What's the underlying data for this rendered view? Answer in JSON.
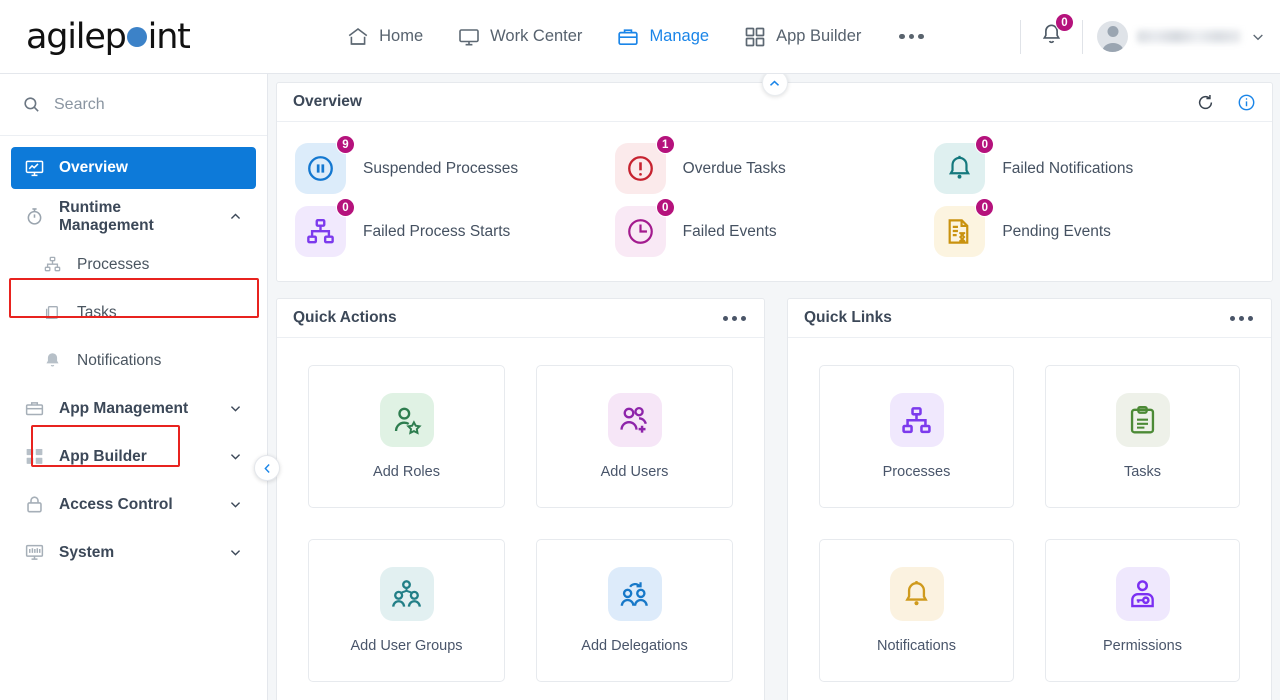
{
  "brand": {
    "name_part1": "agilep",
    "name_part2": "int",
    "dot_color": "#3c82c8"
  },
  "topnav": {
    "items": [
      {
        "label": "Home",
        "icon": "home-icon",
        "active": false
      },
      {
        "label": "Work Center",
        "icon": "monitor-icon",
        "active": false
      },
      {
        "label": "Manage",
        "icon": "briefcase-icon",
        "active": true
      },
      {
        "label": "App Builder",
        "icon": "grid-icon",
        "active": false
      }
    ],
    "more_label": "more-menu",
    "notification_count": "0",
    "user_name": ""
  },
  "sidebar": {
    "search": {
      "placeholder": "Search",
      "value": ""
    },
    "items": [
      {
        "label": "Overview",
        "icon": "dashboard-monitor-icon",
        "active": true,
        "level": 0,
        "caret": ""
      },
      {
        "label": "Runtime Management",
        "icon": "stopwatch-icon",
        "active": false,
        "level": 0,
        "caret": "up",
        "highlighted": true
      },
      {
        "label": "Processes",
        "icon": "org-chart-icon",
        "active": false,
        "level": 1,
        "caret": ""
      },
      {
        "label": "Tasks",
        "icon": "documents-icon",
        "active": false,
        "level": 1,
        "caret": ""
      },
      {
        "label": "Notifications",
        "icon": "bell-icon",
        "active": false,
        "level": 1,
        "caret": "",
        "highlighted": true
      },
      {
        "label": "App Management",
        "icon": "toolbox-icon",
        "active": false,
        "level": 0,
        "caret": "down"
      },
      {
        "label": "App Builder",
        "icon": "app-grid-icon",
        "active": false,
        "level": 0,
        "caret": "down"
      },
      {
        "label": "Access Control",
        "icon": "lock-icon",
        "active": false,
        "level": 0,
        "caret": "down"
      },
      {
        "label": "System",
        "icon": "system-monitor-icon",
        "active": false,
        "level": 0,
        "caret": "down"
      }
    ],
    "collapse_icon": "chevron-left-icon"
  },
  "overview": {
    "title": "Overview",
    "refresh_icon": "refresh-icon",
    "info_icon": "info-icon",
    "collapse_icon": "chevron-up-icon",
    "stats": [
      {
        "label": "Suspended Processes",
        "count": "9",
        "icon": "pause-circle-icon",
        "color": "#1478d0",
        "bg": "#dcecfa"
      },
      {
        "label": "Overdue Tasks",
        "count": "1",
        "icon": "exclamation-circle-icon",
        "color": "#c62330",
        "bg": "#fbeaeb"
      },
      {
        "label": "Failed Notifications",
        "count": "0",
        "icon": "bell-outline-icon",
        "color": "#15797e",
        "bg": "#dff0f0"
      },
      {
        "label": "Failed Process Starts",
        "count": "0",
        "icon": "org-chart-icon",
        "color": "#7c3aed",
        "bg": "#f1e9fd"
      },
      {
        "label": "Failed Events",
        "count": "0",
        "icon": "clock-icon",
        "color": "#a31b8e",
        "bg": "#f9e9f5"
      },
      {
        "label": "Pending Events",
        "count": "0",
        "icon": "document-hourglass-icon",
        "color": "#c9920f",
        "bg": "#fcf4e0"
      }
    ]
  },
  "quick_actions": {
    "title": "Quick Actions",
    "menu_icon": "kebab-menu-icon",
    "tiles": [
      {
        "label": "Add Roles",
        "icon": "person-star-icon",
        "color": "#2e7d4f",
        "bg": "#e0f2e4"
      },
      {
        "label": "Add Users",
        "icon": "people-plus-icon",
        "color": "#8e24aa",
        "bg": "#f6e6f7"
      },
      {
        "label": "Add User Groups",
        "icon": "people-group-icon",
        "color": "#227f87",
        "bg": "#e2f0f1"
      },
      {
        "label": "Add Delegations",
        "icon": "people-arrow-icon",
        "color": "#1778c8",
        "bg": "#ddebfa"
      }
    ]
  },
  "quick_links": {
    "title": "Quick Links",
    "menu_icon": "kebab-menu-icon",
    "tiles": [
      {
        "label": "Processes",
        "icon": "org-chart-icon",
        "color": "#7c3aed",
        "bg": "#f0e8fd"
      },
      {
        "label": "Tasks",
        "icon": "clipboard-icon",
        "color": "#4c8a36",
        "bg": "#eef1e9"
      },
      {
        "label": "Notifications",
        "icon": "bell-outline-icon",
        "color": "#cf9a1d",
        "bg": "#fbf2e0"
      },
      {
        "label": "Permissions",
        "icon": "person-key-icon",
        "color": "#7b2ff2",
        "bg": "#efe8fd"
      }
    ]
  },
  "annotations": {
    "highlight_color": "#e8231f",
    "boxes": [
      "runtime-management",
      "notifications"
    ]
  }
}
